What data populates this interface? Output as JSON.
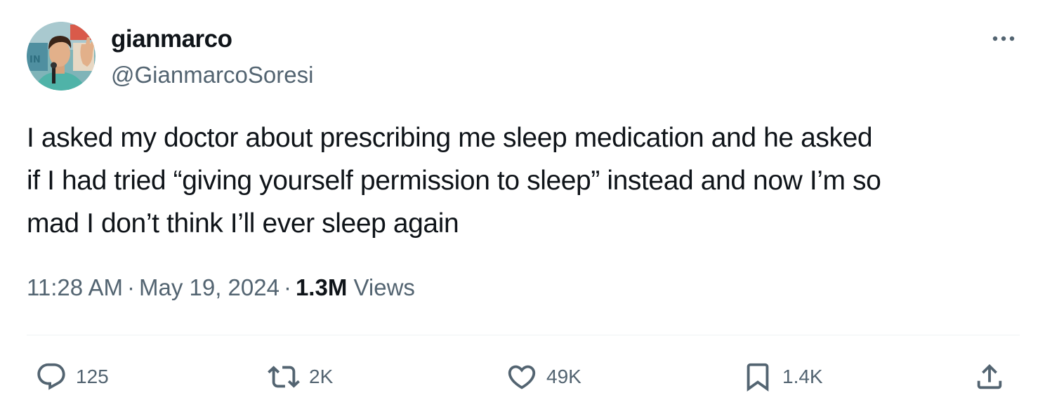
{
  "author": {
    "display_name": "gianmarco",
    "handle": "@GianmarcoSoresi",
    "avatar_icon": "profile-photo"
  },
  "tweet": {
    "text_lines": [
      "I asked my doctor about prescribing me sleep medication and he asked",
      "if I had tried “giving yourself permission to sleep” instead and now I’m so",
      "mad I don’t think I’ll ever sleep again"
    ]
  },
  "meta": {
    "time": "11:28 AM",
    "separator": "·",
    "date": "May 19, 2024",
    "views_count": "1.3M",
    "views_label": "Views"
  },
  "actions": {
    "reply": {
      "icon": "reply-icon",
      "count": "125"
    },
    "retweet": {
      "icon": "retweet-icon",
      "count": "2K"
    },
    "like": {
      "icon": "heart-icon",
      "count": "49K"
    },
    "bookmark": {
      "icon": "bookmark-icon",
      "count": "1.4K"
    },
    "share": {
      "icon": "share-icon"
    }
  },
  "colors": {
    "text_primary": "#0f1419",
    "text_secondary": "#536471",
    "divider": "#eff3f4"
  }
}
